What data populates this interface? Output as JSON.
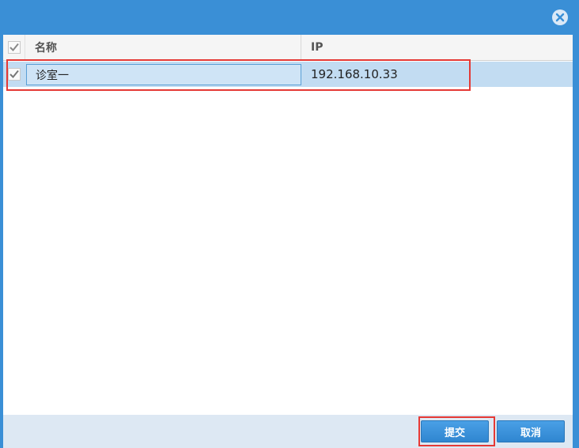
{
  "dialog": {
    "close_icon": "close-icon"
  },
  "grid": {
    "columns": [
      {
        "label": "名称"
      },
      {
        "label": "IP"
      }
    ],
    "rows": [
      {
        "checked": true,
        "name": "诊室一",
        "ip": "192.168.10.33"
      }
    ]
  },
  "footer": {
    "submit_label": "提交",
    "cancel_label": "取消"
  },
  "colors": {
    "titlebar": "#3a8fd6",
    "selected_row": "#c2dcf2",
    "highlight_border": "#e53935",
    "button": "#3a8fd6"
  }
}
